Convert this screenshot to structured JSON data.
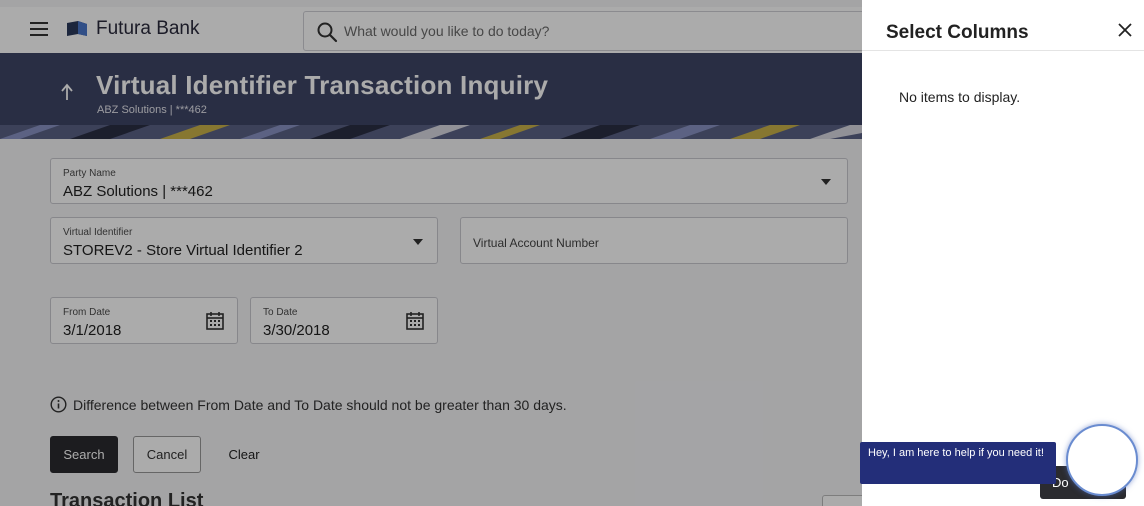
{
  "app": {
    "brand": "Futura Bank",
    "search_placeholder": "What would you like to do today?"
  },
  "header": {
    "title": "Virtual Identifier Transaction Inquiry",
    "subtitle": "ABZ Solutions | ***462"
  },
  "form": {
    "party_name": {
      "label": "Party Name",
      "value": "ABZ Solutions | ***462"
    },
    "virtual_identifier": {
      "label": "Virtual Identifier",
      "value": "STOREV2 - Store Virtual Identifier 2"
    },
    "virtual_account_number": {
      "placeholder": "Virtual Account Number"
    },
    "from_date": {
      "label": "From Date",
      "value": "3/1/2018"
    },
    "to_date": {
      "label": "To Date",
      "value": "3/30/2018"
    },
    "info_text": "Difference between From Date and To Date should not be greater than 30 days."
  },
  "actions": {
    "search": "Search",
    "cancel": "Cancel",
    "clear": "Clear"
  },
  "section": {
    "title": "Transaction List"
  },
  "panel": {
    "title": "Select Columns",
    "empty_message": "No items to display.",
    "done_label": "Do"
  },
  "chat": {
    "message": "Hey, I am here to help if you need it!"
  },
  "colors": {
    "banner": "#3e4566",
    "chat_bubble": "#232e79",
    "primary_button": "#2b2b2f"
  },
  "icons": [
    "menu-icon",
    "bank-logo-icon",
    "search-icon",
    "back-arrow-icon",
    "chevron-down-icon",
    "calendar-icon",
    "info-icon",
    "close-icon"
  ]
}
